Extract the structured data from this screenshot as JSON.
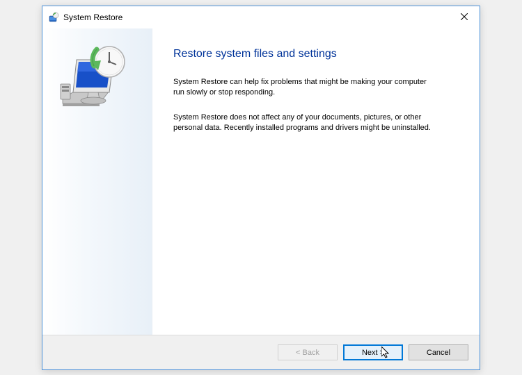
{
  "titlebar": {
    "title": "System Restore"
  },
  "content": {
    "heading": "Restore system files and settings",
    "paragraph1": "System Restore can help fix problems that might be making your computer run slowly or stop responding.",
    "paragraph2": "System Restore does not affect any of your documents, pictures, or other personal data. Recently installed programs and drivers might be uninstalled."
  },
  "footer": {
    "back": "< Back",
    "next": "Next >",
    "cancel": "Cancel"
  }
}
